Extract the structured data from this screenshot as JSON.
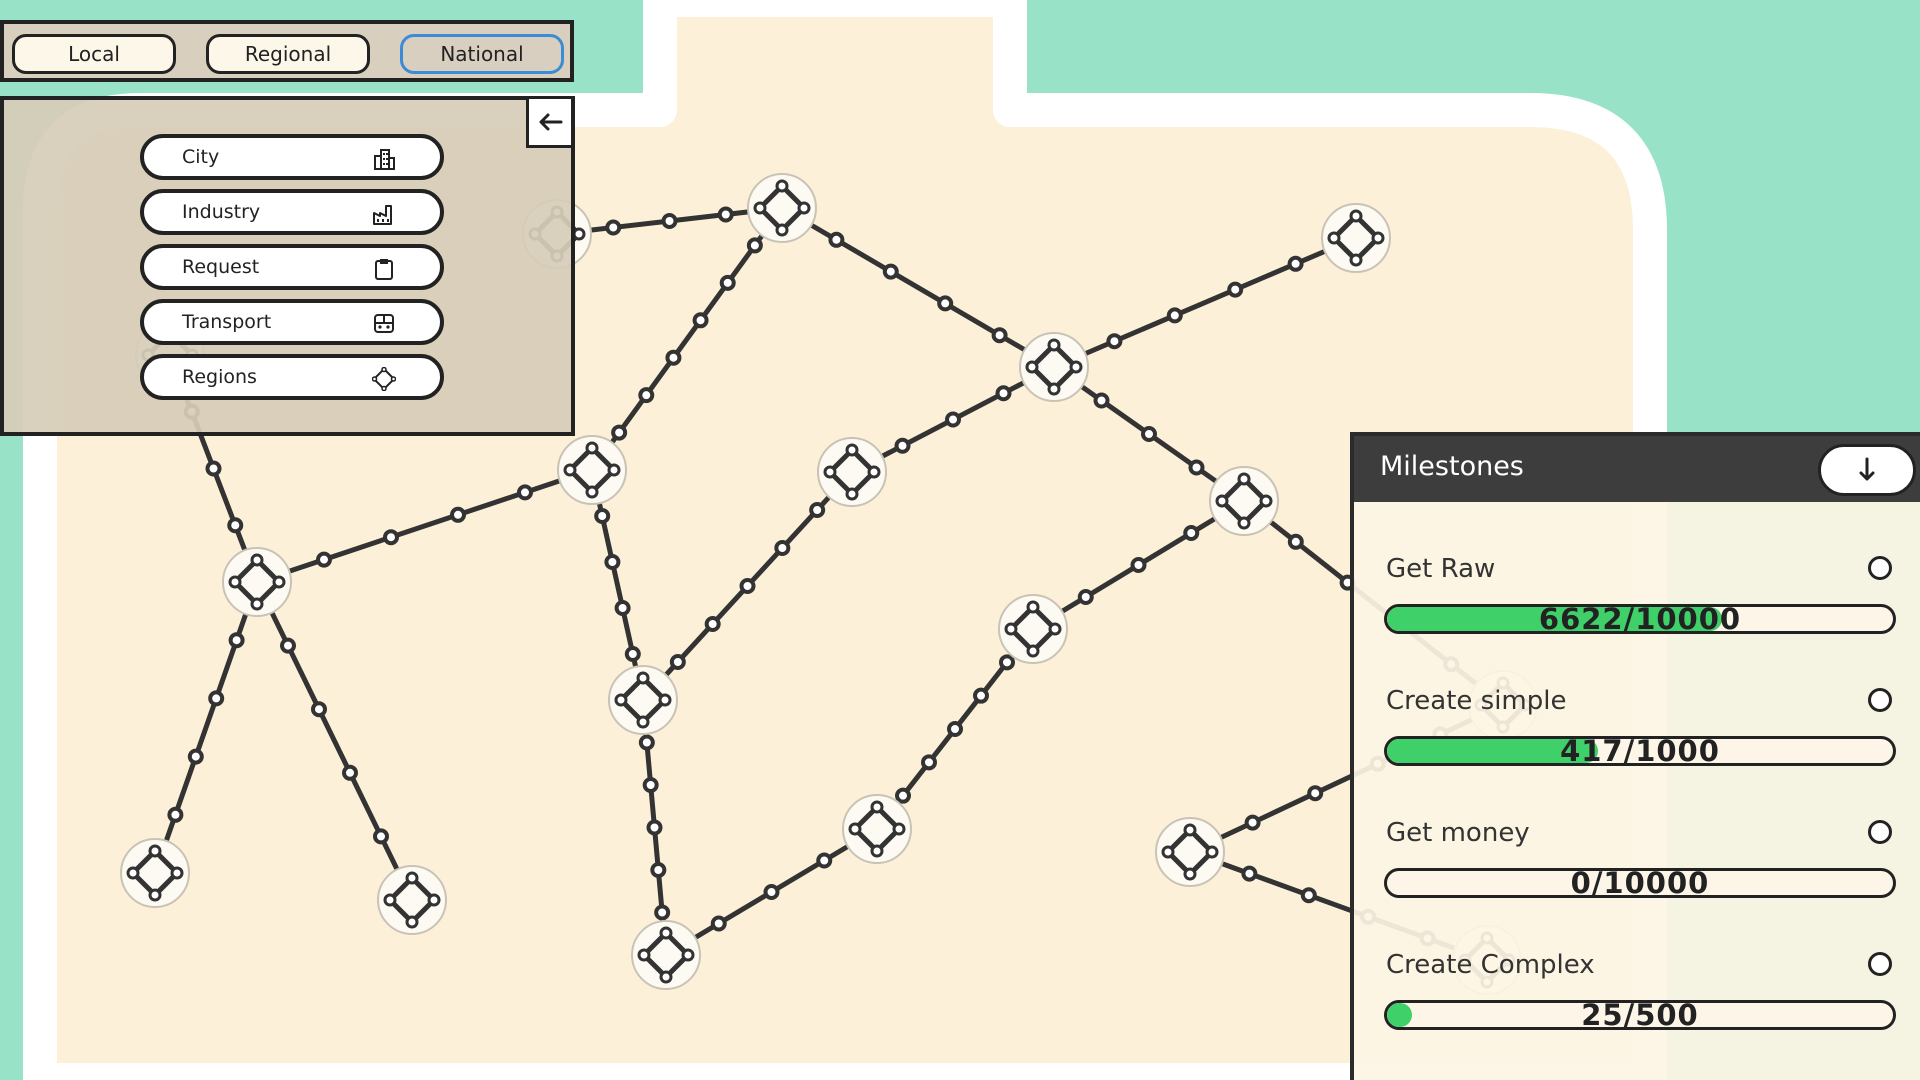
{
  "scope_tabs": [
    {
      "label": "Local",
      "active": false
    },
    {
      "label": "Regional",
      "active": false
    },
    {
      "label": "National",
      "active": true
    }
  ],
  "categories": [
    {
      "label": "City",
      "icon": "city-buildings-icon"
    },
    {
      "label": "Industry",
      "icon": "factory-icon"
    },
    {
      "label": "Request",
      "icon": "clipboard-icon"
    },
    {
      "label": "Transport",
      "icon": "bus-icon"
    },
    {
      "label": "Regions",
      "icon": "diamond-node-icon"
    }
  ],
  "collapse_icon": "arrow-left-icon",
  "milestones": {
    "title": "Milestones",
    "toggle_icon": "arrow-down-icon",
    "items": [
      {
        "name": "Get Raw",
        "progress_text": "6622/10000",
        "progress": 0.6622
      },
      {
        "name": "Create simple",
        "progress_text": "417/1000",
        "progress": 0.417
      },
      {
        "name": "Get money",
        "progress_text": "0/10000",
        "progress": 0
      },
      {
        "name": "Create Complex",
        "progress_text": "25/500",
        "progress": 0.05
      }
    ]
  },
  "colors": {
    "background": "#98e3c8",
    "land": "#fdf0d8",
    "progress_fill": "#3fd06a",
    "active_tab_border": "#3b8bd6",
    "milestone_header": "#3d3d3d"
  }
}
